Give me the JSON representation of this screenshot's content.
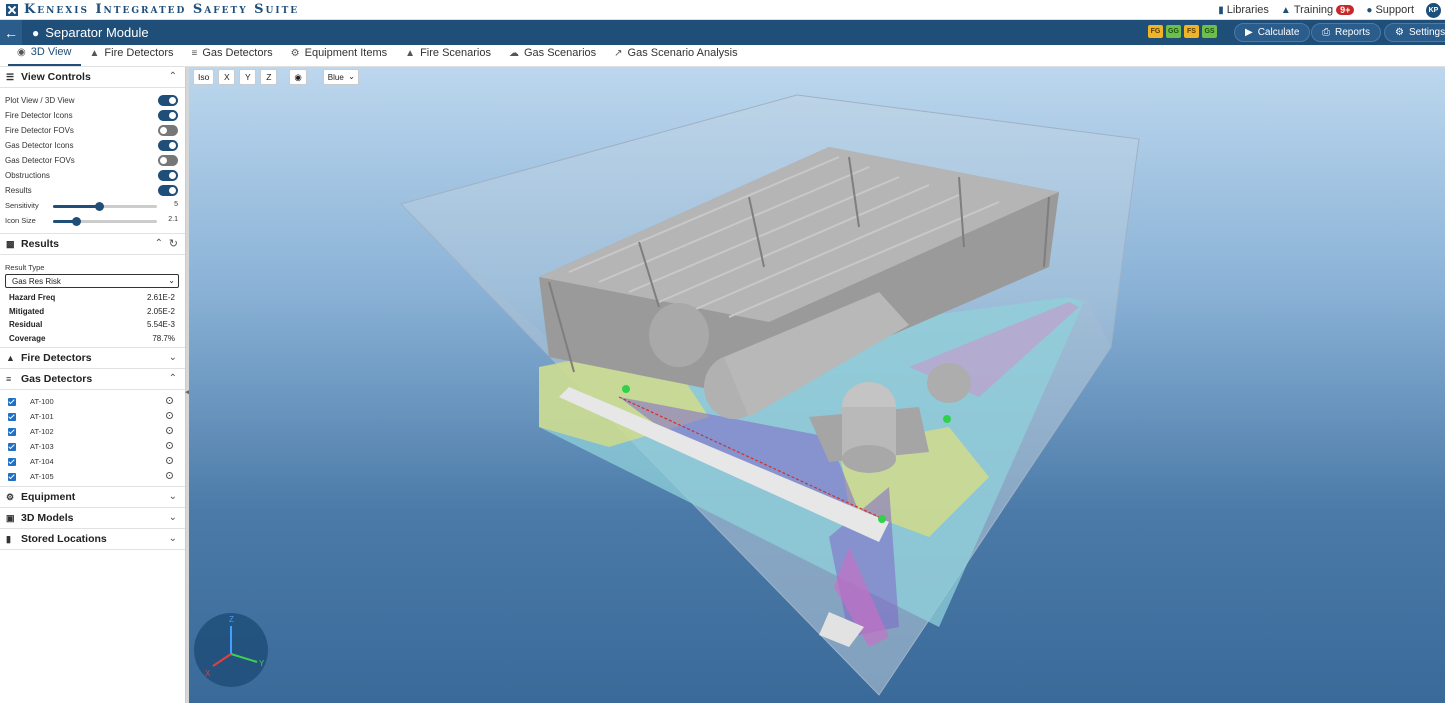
{
  "app": {
    "brand_name": "Kenexis Integrated Safety Suite",
    "links": [
      {
        "label": "Libraries",
        "icon": "book-icon"
      },
      {
        "label": "Training",
        "icon": "graduation-cap-icon",
        "badge": "9+"
      },
      {
        "label": "Support",
        "icon": "chat-bubbles-icon"
      }
    ],
    "user_initials": "KP"
  },
  "module": {
    "title": "Separator Module",
    "status_chips": [
      {
        "label": "FG",
        "color": "#f0b429"
      },
      {
        "label": "GG",
        "color": "#6cc04a"
      },
      {
        "label": "FS",
        "color": "#f0b429"
      },
      {
        "label": "GS",
        "color": "#6cc04a"
      }
    ],
    "calculate_label": "Calculate",
    "reports_label": "Reports",
    "settings_label": "Settings"
  },
  "tabs": [
    {
      "label": "3D View",
      "icon": "cube-icon",
      "active": true
    },
    {
      "label": "Fire Detectors",
      "icon": "flame-icon",
      "active": false
    },
    {
      "label": "Gas Detectors",
      "icon": "gas-icon",
      "active": false
    },
    {
      "label": "Equipment Items",
      "icon": "cogs-icon",
      "active": false
    },
    {
      "label": "Fire Scenarios",
      "icon": "flame-icon",
      "active": false
    },
    {
      "label": "Gas Scenarios",
      "icon": "cloud-icon",
      "active": false
    },
    {
      "label": "Gas Scenario Analysis",
      "icon": "line-chart-icon",
      "active": false
    }
  ],
  "view_controls": {
    "title": "View Controls",
    "toggles": [
      {
        "label": "Plot View / 3D View",
        "on": true
      },
      {
        "label": "Fire Detector Icons",
        "on": true
      },
      {
        "label": "Fire Detector FOVs",
        "on": false
      },
      {
        "label": "Gas Detector Icons",
        "on": true
      },
      {
        "label": "Gas Detector FOVs",
        "on": false
      },
      {
        "label": "Obstructions",
        "on": true
      },
      {
        "label": "Results",
        "on": true
      }
    ],
    "sensitivity": {
      "label": "Sensitivity",
      "value": "5",
      "fraction": 0.45
    },
    "icon_size": {
      "label": "Icon Size",
      "value": "2.1",
      "fraction": 0.22
    }
  },
  "results": {
    "title": "Results",
    "result_type_label": "Result Type",
    "result_type_value": "Gas Res Risk",
    "metrics": [
      {
        "label": "Hazard Freq",
        "value": "2.61E-2"
      },
      {
        "label": "Mitigated",
        "value": "2.05E-2"
      },
      {
        "label": "Residual",
        "value": "5.54E-3"
      },
      {
        "label": "Coverage",
        "value": "78.7%"
      }
    ]
  },
  "fire_detectors_title": "Fire Detectors",
  "gas_detectors": {
    "title": "Gas Detectors",
    "items": [
      "AT-100",
      "AT-101",
      "AT-102",
      "AT-103",
      "AT-104",
      "AT-105"
    ]
  },
  "equipment_title": "Equipment",
  "models_title": "3D Models",
  "stored_locations_title": "Stored Locations",
  "viewport": {
    "view_buttons": [
      "Iso",
      "X",
      "Y",
      "Z"
    ],
    "color_scheme": "Blue",
    "axis_labels": {
      "x": "X",
      "y": "Y",
      "z": "Z"
    }
  }
}
